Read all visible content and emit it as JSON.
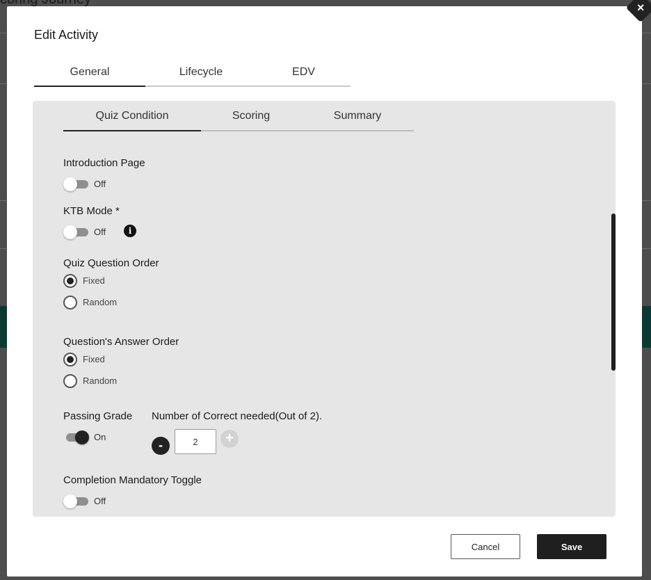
{
  "background": {
    "page_title_fragment": "coring Journey"
  },
  "modal": {
    "title": "Edit Activity",
    "close_glyph": "×",
    "top_tabs": [
      "General",
      "Lifecycle",
      "EDV"
    ],
    "sub_tabs": [
      "Quiz Condition",
      "Scoring",
      "Summary"
    ],
    "introduction_page": {
      "label": "Introduction Page",
      "state": "Off"
    },
    "ktb_mode": {
      "label": "KTB Mode *",
      "state": "Off",
      "info_glyph": "i"
    },
    "quiz_question_order": {
      "label": "Quiz Question Order",
      "options": [
        "Fixed",
        "Random"
      ],
      "selected": "Fixed"
    },
    "answer_order": {
      "label": "Question's Answer Order",
      "options": [
        "Fixed",
        "Random"
      ],
      "selected": "Fixed"
    },
    "passing_grade": {
      "label": "Passing Grade",
      "state": "On"
    },
    "correct_needed": {
      "label": "Number of Correct needed(Out of 2).",
      "value": "2",
      "minus": "-",
      "plus": "+"
    },
    "completion_mandatory": {
      "label": "Completion Mandatory Toggle",
      "state": "Off"
    },
    "cancel_label": "Cancel",
    "save_label": "Save"
  },
  "colors": {
    "accent_dark": "#1f1f1f",
    "panel_bg": "#e6e6e6",
    "backdrop": "#4d4d4d"
  }
}
